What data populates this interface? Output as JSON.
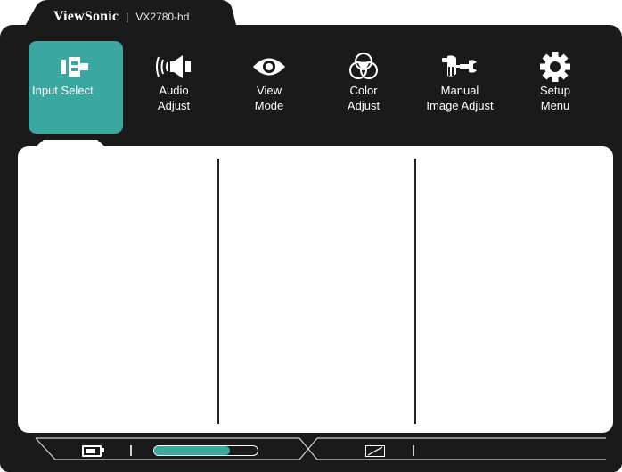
{
  "brand": {
    "name": "ViewSonic",
    "separator": "|",
    "model": "VX2780-hd"
  },
  "menu": {
    "items": [
      {
        "id": "input-select",
        "label": "Input Select",
        "icon": "input-select-icon",
        "active": true
      },
      {
        "id": "audio-adjust",
        "label": "Audio\nAdjust",
        "icon": "speaker-icon",
        "active": false
      },
      {
        "id": "view-mode",
        "label": "View\nMode",
        "icon": "eye-icon",
        "active": false
      },
      {
        "id": "color-adjust",
        "label": "Color\nAdjust",
        "icon": "rgb-circles-icon",
        "active": false
      },
      {
        "id": "manual-image-adjust",
        "label": "Manual\nImage Adjust",
        "icon": "hand-wrench-icon",
        "active": false
      },
      {
        "id": "setup-menu",
        "label": "Setup\nMenu",
        "icon": "gear-icon",
        "active": false
      }
    ]
  },
  "status": {
    "battery_icon": "battery-icon",
    "progress_fraction": 0.73,
    "aspect_icon": "aspect-ratio-icon"
  },
  "colors": {
    "accent": "#3aa7a0",
    "background": "#1a1a1a",
    "panel": "#ffffff"
  }
}
